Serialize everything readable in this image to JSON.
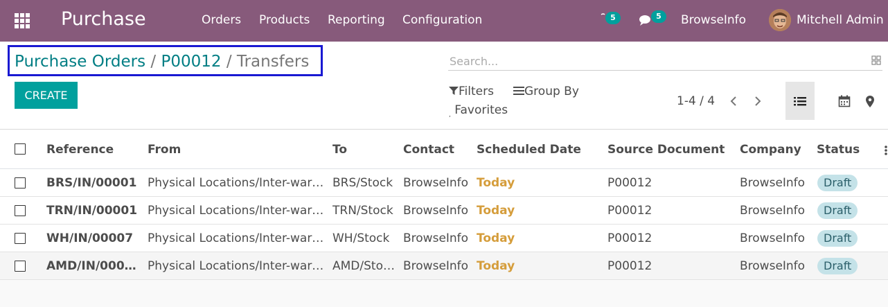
{
  "navbar": {
    "app_title": "Purchase",
    "menus": [
      "Orders",
      "Products",
      "Reporting",
      "Configuration"
    ],
    "activity_count": "5",
    "messages_count": "5",
    "company": "BrowseInfo",
    "user": "Mitchell Admin",
    "bg_color": "#875a7b"
  },
  "breadcrumb": {
    "items": [
      "Purchase Orders",
      "P00012"
    ],
    "active": "Transfers",
    "separator": "/"
  },
  "toolbar": {
    "create_label": "CREATE"
  },
  "search": {
    "placeholder": "Search...",
    "filters_label": "Filters",
    "groupby_label": "Group By",
    "favorites_label": "Favorites"
  },
  "pager": {
    "text": "1-4 / 4"
  },
  "table": {
    "columns": [
      "Reference",
      "From",
      "To",
      "Contact",
      "Scheduled Date",
      "Source Document",
      "Company",
      "Status"
    ],
    "rows": [
      {
        "reference": "BRS/IN/00001",
        "from": "Physical Locations/Inter-war…",
        "to": "BRS/Stock",
        "contact": "BrowseInfo",
        "scheduled": "Today",
        "source": "P00012",
        "company": "BrowseInfo",
        "status": "Draft"
      },
      {
        "reference": "TRN/IN/00001",
        "from": "Physical Locations/Inter-war…",
        "to": "TRN/Stock",
        "contact": "BrowseInfo",
        "scheduled": "Today",
        "source": "P00012",
        "company": "BrowseInfo",
        "status": "Draft"
      },
      {
        "reference": "WH/IN/00007",
        "from": "Physical Locations/Inter-war…",
        "to": "WH/Stock",
        "contact": "BrowseInfo",
        "scheduled": "Today",
        "source": "P00012",
        "company": "BrowseInfo",
        "status": "Draft"
      },
      {
        "reference": "AMD/IN/000…",
        "from": "Physical Locations/Inter-war…",
        "to": "AMD/Sto…",
        "contact": "BrowseInfo",
        "scheduled": "Today",
        "source": "P00012",
        "company": "BrowseInfo",
        "status": "Draft"
      }
    ]
  },
  "colors": {
    "accent": "#00a09d",
    "link": "#017e84",
    "today": "#d59d3b",
    "highlight_box": "#1919d2"
  }
}
